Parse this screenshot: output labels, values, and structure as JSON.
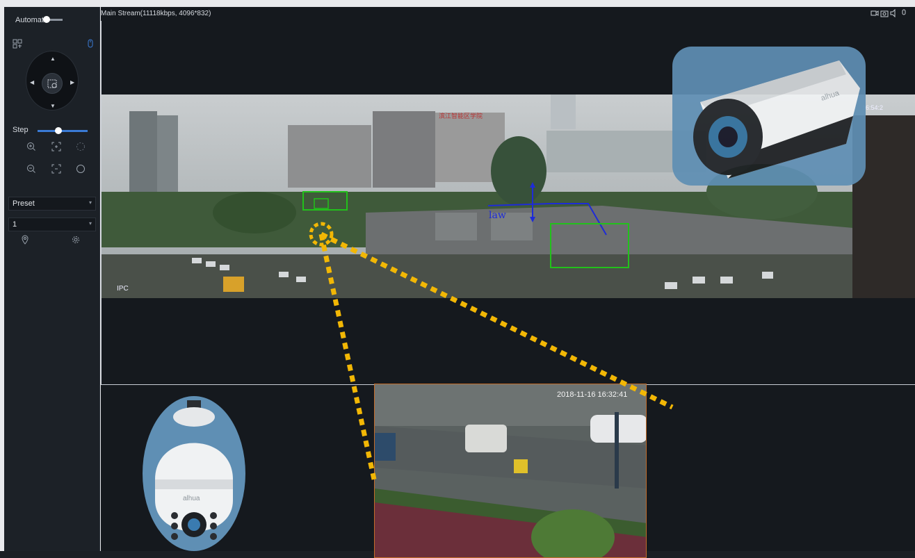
{
  "sidebar": {
    "mode_label": "Automatic",
    "step_label": "Step",
    "preset_select": "Preset",
    "preset_number": "1",
    "icons": [
      "grid-icon",
      "mouse-icon",
      "zoom-in-icon",
      "focus-near-icon",
      "iris-open-icon",
      "zoom-out-icon",
      "focus-far-icon",
      "iris-close-icon",
      "location-pin-icon",
      "gear-icon"
    ]
  },
  "stream": {
    "title": "Main Stream(11118kbps, 4096*832)",
    "toolbar_icons": [
      "record-icon",
      "snapshot-icon",
      "audio-icon",
      "mic-icon"
    ]
  },
  "panorama": {
    "building_sign": "滨江智能区学院",
    "line_label": "law",
    "overlay_label": "IPC",
    "timestamp_partial": "16:54:2"
  },
  "inset": {
    "timestamp": "2018-11-16 16:32:41"
  },
  "overlays": {
    "bullet_camera_brand": "alhua",
    "dome_camera_brand": "alhua"
  },
  "colors": {
    "accent_blue": "#3a7bd5",
    "dotted_line": "#f2b705",
    "detection_box": "#22c11b",
    "tripwire": "#1e2bd8",
    "camera_badge_bg": "#5f8fb4"
  }
}
